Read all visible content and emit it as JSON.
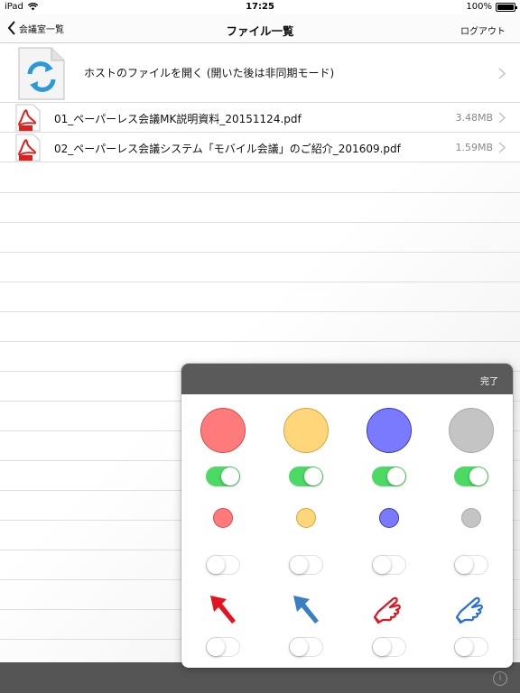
{
  "status": {
    "device": "iPad",
    "time": "17:25",
    "battery": "100%"
  },
  "nav": {
    "back_label": "会議室一覧",
    "title": "ファイル一覧",
    "logout_label": "ログアウト"
  },
  "host": {
    "label": "ホストのファイルを開く (開いた後は非同期モード)"
  },
  "files": [
    {
      "name": "01_ペーパーレス会議MK説明資料_20151124.pdf",
      "size": "3.48MB"
    },
    {
      "name": "02_ペーパーレス会議システム「モバイル会議」のご紹介_201609.pdf",
      "size": "1.59MB"
    }
  ],
  "popover": {
    "done_label": "完了",
    "large_colors": [
      "#ff7a7a",
      "#ffd77a",
      "#7a7aff",
      "#c4c4c4"
    ],
    "large_switches": [
      true,
      true,
      true,
      true
    ],
    "small_colors": [
      "#ff7a7a",
      "#ffd77a",
      "#7a7aff",
      "#c4c4c4"
    ],
    "small_switches": [
      false,
      false,
      false,
      false
    ],
    "pointers": [
      "red-arrow-icon",
      "blue-arrow-icon",
      "red-pointing-hand-icon",
      "blue-pointing-hand-icon"
    ],
    "pointer_switches": [
      false,
      false,
      false,
      false
    ]
  }
}
